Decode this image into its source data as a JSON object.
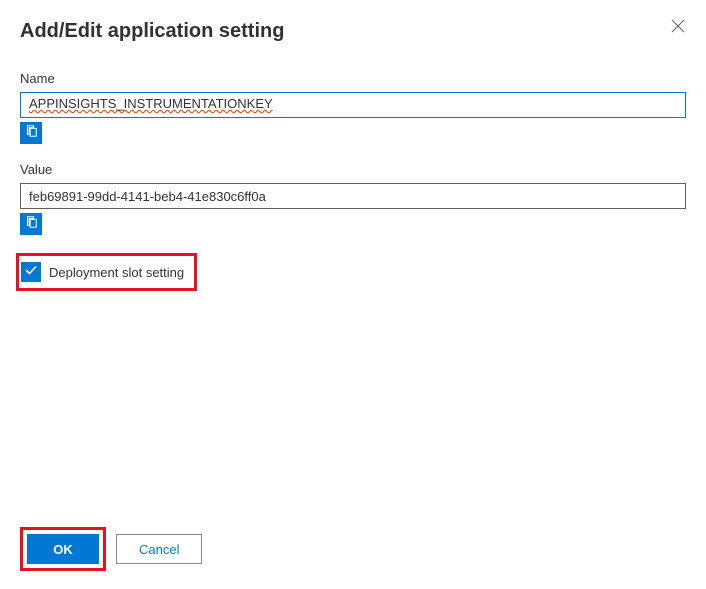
{
  "header": {
    "title": "Add/Edit application setting"
  },
  "fields": {
    "name": {
      "label": "Name",
      "value": "APPINSIGHTS_INSTRUMENTATIONKEY"
    },
    "value": {
      "label": "Value",
      "value": "feb69891-99dd-4141-beb4-41e830c6ff0a"
    }
  },
  "checkbox": {
    "label": "Deployment slot setting",
    "checked": true
  },
  "buttons": {
    "ok": "OK",
    "cancel": "Cancel"
  }
}
